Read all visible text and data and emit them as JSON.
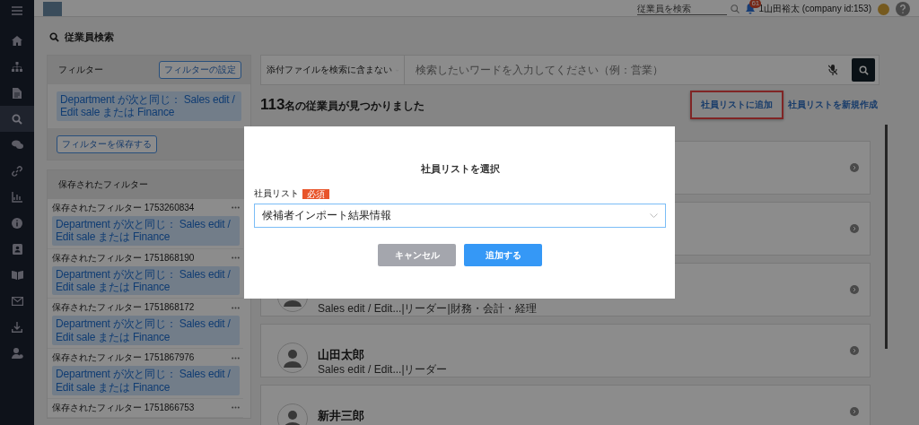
{
  "header": {
    "search_placeholder": "従業員を検索",
    "notification_count": "61",
    "user": "1山田裕太 (company id:153)"
  },
  "sidebar": {
    "items": [
      {
        "selected": false
      },
      {
        "selected": false
      },
      {
        "selected": false
      },
      {
        "selected": true
      },
      {
        "selected": false
      },
      {
        "selected": false
      },
      {
        "selected": false
      },
      {
        "selected": false
      },
      {
        "selected": false
      },
      {
        "selected": false
      },
      {
        "selected": false
      },
      {
        "selected": false
      },
      {
        "selected": false
      }
    ]
  },
  "page_title": "従業員検索",
  "filter": {
    "title": "フィルター",
    "settings_button": "フィルターの設定",
    "condition": "Department が次と同じ： Sales edit / Edit sale または Finance",
    "save_button": "フィルターを保存する"
  },
  "saved_filters": {
    "title": "保存されたフィルター",
    "items": [
      {
        "name": "保存されたフィルター 1753260834",
        "condition": "Department が次と同じ： Sales edit / Edit sale または Finance"
      },
      {
        "name": "保存されたフィルター 1751868190",
        "condition": "Department が次と同じ： Sales edit / Edit sale または Finance"
      },
      {
        "name": "保存されたフィルター 1751868172",
        "condition": "Department が次と同じ： Sales edit / Edit sale または Finance"
      },
      {
        "name": "保存されたフィルター 1751867976",
        "condition": "Department が次と同じ： Sales edit / Edit sale または Finance"
      },
      {
        "name": "保存されたフィルター 1751866753"
      }
    ]
  },
  "search": {
    "attachment_option": "添付ファイルを検索に含まない",
    "placeholder": "検索したいワードを入力してください（例：営業）"
  },
  "results": {
    "count": "113",
    "count_suffix": "名の従業員が見つかりました",
    "add_to_list_link": "社員リストに追加",
    "add_to_list_highlighted": true,
    "new_list_link": "社員リストを新規作成"
  },
  "employees": [
    {
      "avatar": false
    },
    {
      "avatar": false
    },
    {
      "avatar": true,
      "subtitle": "Sales edit / Edit...|リーダー|財務・会計・経理"
    },
    {
      "avatar": true,
      "name": "山田太郎",
      "subtitle": "Sales edit / Edit...|リーダー"
    },
    {
      "avatar": true,
      "name": "新井三郎"
    }
  ],
  "modal": {
    "title": "社員リストを選択",
    "field_label": "社員リスト",
    "required_badge": "必須",
    "selected_value": "候補者インポート結果情報",
    "cancel_button": "キャンセル",
    "submit_button": "追加する"
  }
}
